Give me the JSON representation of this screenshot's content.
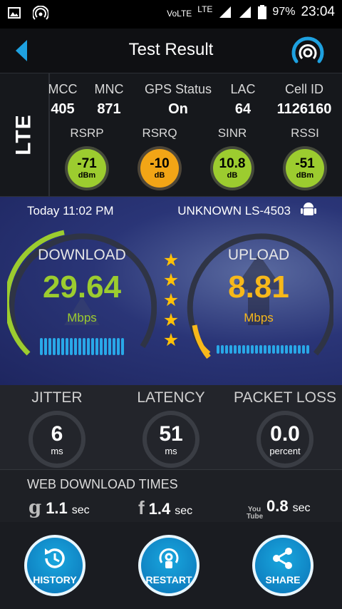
{
  "status_bar": {
    "volte": "VoLTE",
    "lte": "LTE",
    "battery": "97%",
    "time": "23:04"
  },
  "header": {
    "title": "Test Result"
  },
  "network": {
    "technology": "LTE",
    "cell": [
      {
        "label": "MCC",
        "value": "405"
      },
      {
        "label": "MNC",
        "value": "871"
      },
      {
        "label": "GPS Status",
        "value": "On"
      },
      {
        "label": "LAC",
        "value": "64"
      },
      {
        "label": "Cell ID",
        "value": "1126160"
      }
    ],
    "signal": [
      {
        "label": "RSRP",
        "value": "-71",
        "unit": "dBm",
        "color": "#9ccc2f"
      },
      {
        "label": "RSRQ",
        "value": "-10",
        "unit": "dB",
        "color": "#f2a516"
      },
      {
        "label": "SINR",
        "value": "10.8",
        "unit": "dB",
        "color": "#9ccc2f"
      },
      {
        "label": "RSSI",
        "value": "-51",
        "unit": "dBm",
        "color": "#9ccc2f"
      }
    ]
  },
  "result": {
    "date": "Today 11:02 PM",
    "device": "UNKNOWN LS-4503",
    "download": {
      "label": "DOWNLOAD",
      "value": "29.64",
      "unit": "Mbps",
      "color": "#9ccc2f"
    },
    "upload": {
      "label": "UPLOAD",
      "value": "8.81",
      "unit": "Mbps",
      "color": "#f7b81a"
    },
    "stars": 5
  },
  "metrics": [
    {
      "label": "JITTER",
      "value": "6",
      "unit": "ms"
    },
    {
      "label": "LATENCY",
      "value": "51",
      "unit": "ms"
    },
    {
      "label": "PACKET LOSS",
      "value": "0.0",
      "unit": "percent"
    }
  ],
  "web": {
    "title": "WEB DOWNLOAD TIMES",
    "items": [
      {
        "icon": "google-icon",
        "glyph": "g",
        "value": "1.1",
        "unit": "sec"
      },
      {
        "icon": "facebook-icon",
        "glyph": "f",
        "value": "1.4",
        "unit": "sec"
      },
      {
        "icon": "youtube-icon",
        "glyph": "You Tube",
        "value": "0.8",
        "unit": "sec"
      }
    ]
  },
  "buttons": {
    "history": "HISTORY",
    "restart": "RESTART",
    "share": "SHARE"
  }
}
